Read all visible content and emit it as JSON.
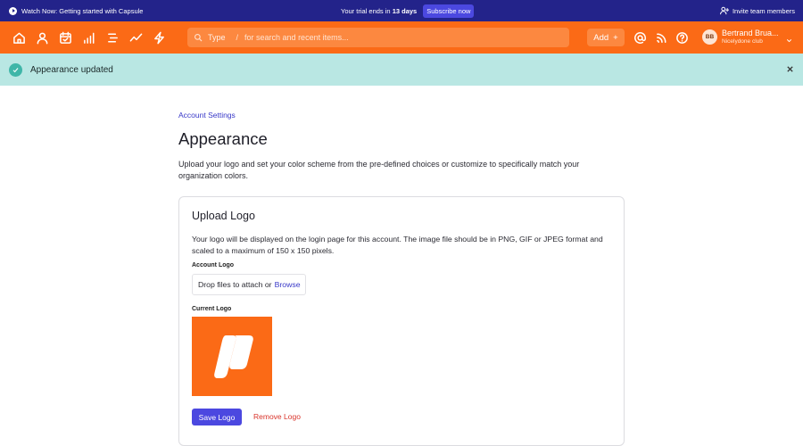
{
  "topbar": {
    "watch_label": "Watch Now: Getting started with Capsule",
    "trial_prefix": "Your trial ends in",
    "trial_days": "13 days",
    "subscribe_label": "Subscribe now",
    "invite_label": "Invite team members"
  },
  "nav": {
    "icons": [
      "home-icon",
      "person-icon",
      "calendar-icon",
      "bar-chart-icon",
      "list-icon",
      "trend-icon",
      "bolt-icon"
    ],
    "search": {
      "type_label": "Type",
      "slash": "/",
      "placeholder": "for search and recent items..."
    },
    "add_label": "Add",
    "add_plus": "+",
    "user": {
      "initials": "BB",
      "name": "Bertrand Brua...",
      "org": "Nicelydone club"
    }
  },
  "alert": {
    "message": "Appearance updated"
  },
  "page": {
    "breadcrumb": "Account Settings",
    "title": "Appearance",
    "description": "Upload your logo and set your color scheme from the pre-defined choices or customize to specifically match your organization colors."
  },
  "upload_card": {
    "title": "Upload Logo",
    "description": "Your logo will be displayed on the login page for this account. The image file should be in PNG, GIF or JPEG format and scaled to a maximum of 150 x 150 pixels.",
    "account_logo_label": "Account Logo",
    "drop_text": "Drop files to attach or",
    "browse_label": "Browse",
    "current_logo_label": "Current Logo",
    "save_label": "Save Logo",
    "remove_label": "Remove Logo"
  },
  "colors": {
    "topbar": "#23238a",
    "navbar": "#fb6a16",
    "alert": "#b9e7e3",
    "primary": "#4b48e0",
    "danger": "#d9342b"
  }
}
